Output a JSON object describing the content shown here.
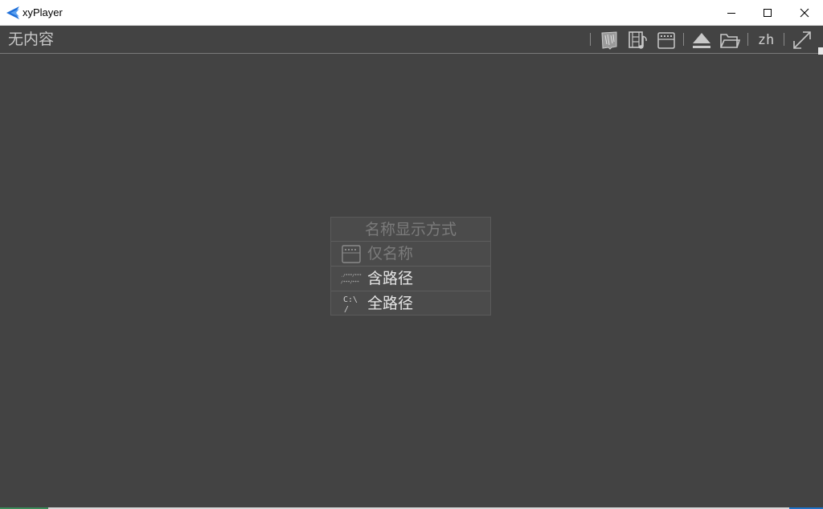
{
  "window": {
    "title": "xyPlayer",
    "logo_icon": "blue-arrow-logo-icon",
    "controls": [
      "minimize-icon",
      "maximize-icon",
      "close-icon"
    ]
  },
  "toolbar": {
    "status": "无内容",
    "buttons": [
      "cover-image-icon",
      "film-music-icon",
      "folder-file-icon",
      "eject-icon",
      "open-folder-icon",
      "language",
      "fullscreen-icon"
    ],
    "language_label": "zh"
  },
  "name_menu": {
    "header": "名称显示方式",
    "items": [
      {
        "label": "仅名称",
        "icon": "file-icon",
        "enabled": false
      },
      {
        "label": "含路径",
        "icon": "relative-path-icon",
        "icon_text_top": "./***/***",
        "icon_text_bottom": "/***/***",
        "enabled": true
      },
      {
        "label": "全路径",
        "icon": "drive-path-icon",
        "icon_text_top": "C:\\",
        "icon_text_bottom": "/",
        "enabled": true
      }
    ]
  },
  "colors": {
    "background": "#434343",
    "menu_bg": "#4b4b4b",
    "text_enabled": "#e6e6e6",
    "text_disabled": "#7b7b7b",
    "logo": "#1e6fd9"
  }
}
